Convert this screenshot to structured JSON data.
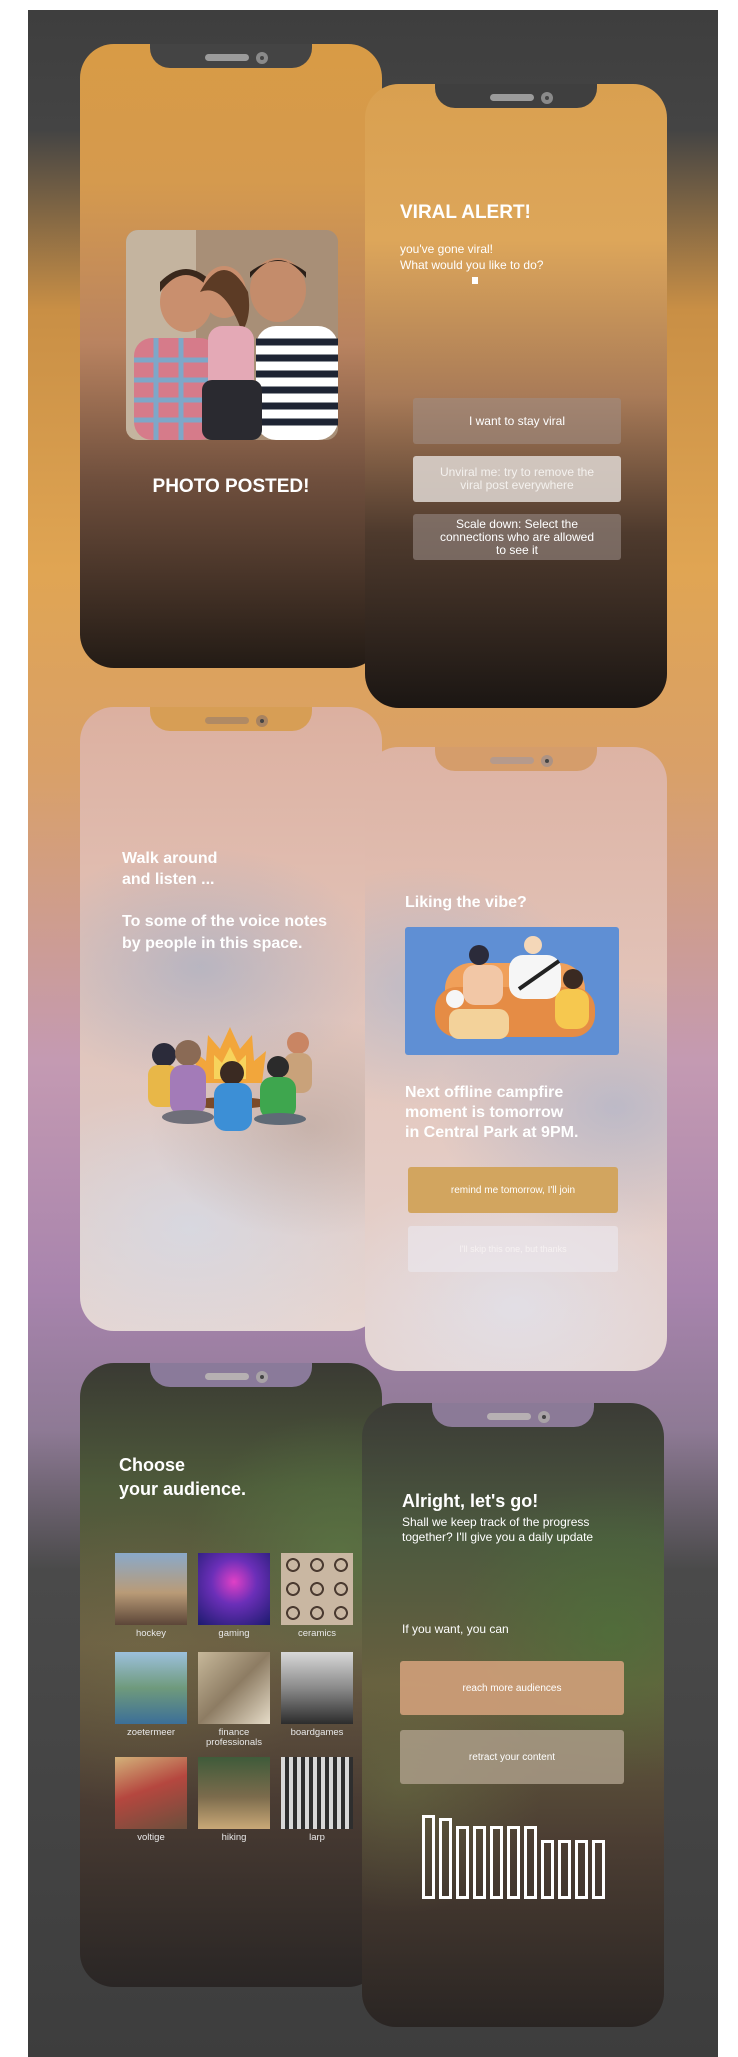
{
  "screen1": {
    "title": "PHOTO POSTED!"
  },
  "screen2": {
    "title": "VIRAL ALERT!",
    "line1": "you've gone viral!",
    "line2": "What would you like to do?",
    "buttons": [
      "I want to stay viral",
      "Unviral me: try to remove the viral post everywhere",
      "Scale down: Select the connections who are allowed to see it"
    ]
  },
  "screen3": {
    "line1": "Walk around",
    "line2": "and listen ...",
    "line3": "To some of the voice notes",
    "line4": "by people in this space."
  },
  "screen4": {
    "title": "Liking the vibe?",
    "line1": "Next offline campfire",
    "line2": "moment is tomorrow",
    "line3": "in Central Park at 9PM.",
    "primary_button": "remind me tomorrow, I'll join",
    "secondary_button": "I'll skip this one, but thanks"
  },
  "screen5": {
    "title_line1": "Choose",
    "title_line2": "your audience.",
    "tiles": [
      "hockey",
      "gaming",
      "ceramics",
      "zoetermeer",
      "finance professionals",
      "boardgames",
      "voltige",
      "hiking",
      "larp"
    ]
  },
  "screen6": {
    "title": "Alright, let's go!",
    "line1": "Shall we keep track of the progress",
    "line2": "together? I'll give you a daily update",
    "prompt": "If you want, you can",
    "button1": "reach more audiences",
    "button2": "retract your content"
  },
  "progress_bars": [
    1.0,
    0.97,
    0.87,
    0.87,
    0.87,
    0.87,
    0.87,
    0.7,
    0.7,
    0.7,
    0.7
  ],
  "colors": {
    "board_dark": "#3e3e3e",
    "accent_gold": "#d2a55f",
    "accent_tan": "#cf9f78"
  }
}
